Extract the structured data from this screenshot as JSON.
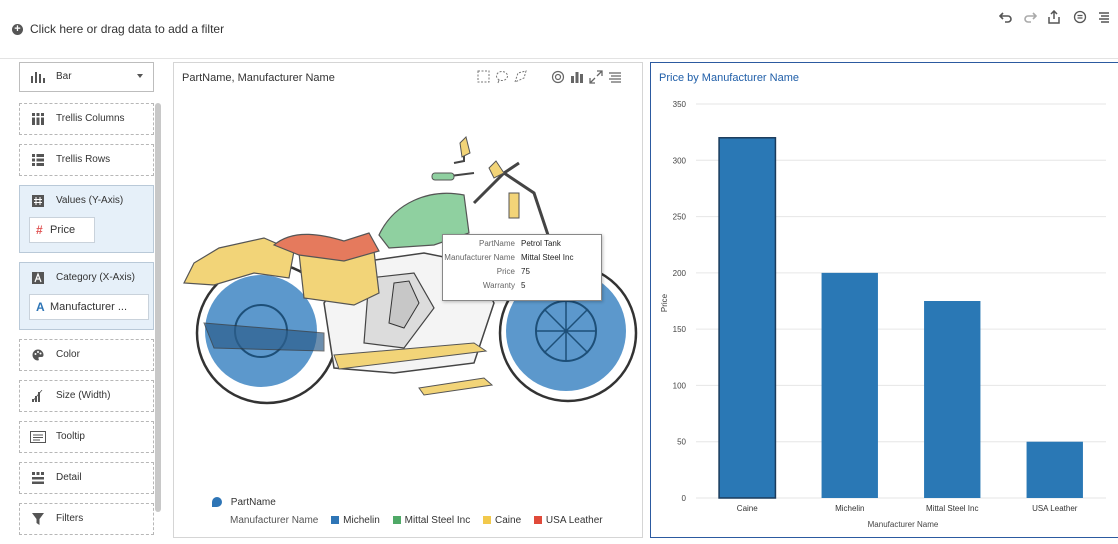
{
  "filterbar": {
    "text": "Click here or drag data to add a filter"
  },
  "toolbar": {
    "icons": [
      "undo-icon",
      "redo-icon",
      "share-icon",
      "comment-icon",
      "menu-icon"
    ]
  },
  "left_pane": {
    "chart_type": "Bar",
    "trellis_columns": "Trellis Columns",
    "trellis_rows": "Trellis Rows",
    "values_y": "Values (Y-Axis)",
    "values_pill": "Price",
    "category_x": "Category (X-Axis)",
    "category_pill": "Manufacturer ...",
    "color": "Color",
    "size": "Size (Width)",
    "tooltip": "Tooltip",
    "detail": "Detail",
    "filters": "Filters"
  },
  "image_panel": {
    "title": "PartName, Manufacturer Name",
    "legend": {
      "shape_label": "PartName",
      "color_label": "Manufacturer Name",
      "items": [
        {
          "name": "Michelin",
          "color": "#2e75b6"
        },
        {
          "name": "Mittal Steel Inc",
          "color": "#4fa967"
        },
        {
          "name": "Caine",
          "color": "#f2c94c"
        },
        {
          "name": "USA Leather",
          "color": "#e04a3a"
        }
      ]
    },
    "tooltip": {
      "rows": [
        {
          "key": "PartName",
          "value": "Petrol Tank"
        },
        {
          "key": "Manufacturer Name",
          "value": "Mittal Steel Inc"
        },
        {
          "key": "Price",
          "value": "75"
        },
        {
          "key": "Warranty",
          "value": "5"
        }
      ]
    }
  },
  "chart_data": {
    "type": "bar",
    "title": "Price by Manufacturer Name",
    "categories": [
      "Caine",
      "Michelin",
      "Mittal Steel Inc",
      "USA Leather"
    ],
    "values": [
      320,
      200,
      175,
      50
    ],
    "xlabel": "Manufacturer Name",
    "ylabel": "Price",
    "ylim": [
      0,
      350
    ],
    "yticks": [
      "0",
      "50",
      "100",
      "150",
      "200",
      "250",
      "300",
      "350"
    ],
    "bar_color": "#2a78b5",
    "grid": true
  }
}
